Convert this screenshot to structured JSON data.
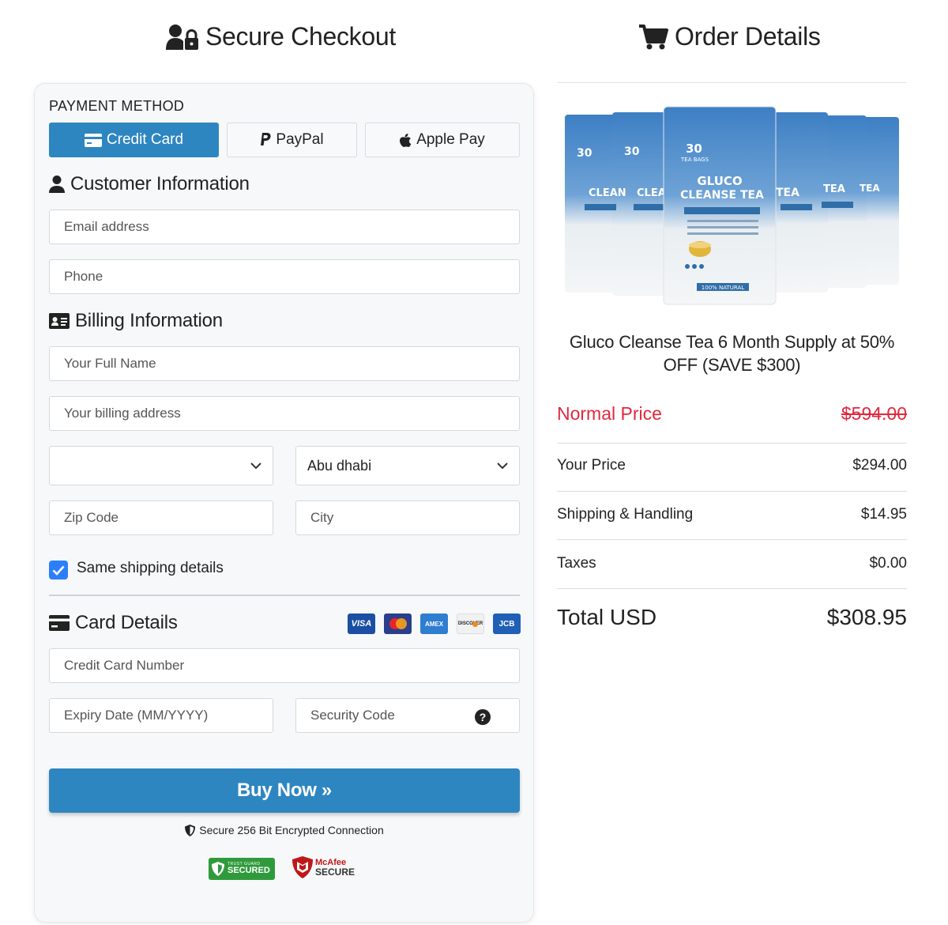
{
  "headers": {
    "checkout_title": "Secure Checkout",
    "order_title": "Order Details"
  },
  "payment": {
    "label": "PAYMENT METHOD",
    "tabs": [
      {
        "label": "Credit Card",
        "icon": "credit-card-icon",
        "active": true
      },
      {
        "label": "PayPal",
        "icon": "paypal-icon",
        "active": false
      },
      {
        "label": "Apple Pay",
        "icon": "apple-icon",
        "active": false
      }
    ]
  },
  "customer": {
    "heading": "Customer Information",
    "email_placeholder": "Email address",
    "phone_placeholder": "Phone"
  },
  "billing": {
    "heading": "Billing Information",
    "name_placeholder": "Your Full Name",
    "address_placeholder": "Your billing address",
    "country_value": "",
    "state_value": "Abu dhabi",
    "zip_placeholder": "Zip Code",
    "city_placeholder": "City",
    "same_shipping_label": "Same shipping details",
    "same_shipping_checked": true
  },
  "card": {
    "heading": "Card Details",
    "logos": [
      "VISA",
      "MASTERCARD",
      "AMEX",
      "DISCOVER",
      "JCB"
    ],
    "number_placeholder": "Credit Card Number",
    "expiry_placeholder": "Expiry Date (MM/YYYY)",
    "cvv_placeholder": "Security Code"
  },
  "buy_button": "Buy Now »",
  "secure_note": "Secure 256 Bit Encrypted Connection",
  "badges": {
    "trust_top": "TRUST GUARD",
    "trust_main": "SECURED",
    "mcafee_top": "McAfee",
    "mcafee_main": "SECURE"
  },
  "product": {
    "bag_count": "30",
    "bag_count_unit": "TEA BAGS",
    "bag_brand_1": "GLUCO",
    "bag_brand_2": "CLEANSE TEA",
    "bag_footer": "100% NATURAL",
    "name": "Gluco Cleanse Tea 6 Month Supply at 50% OFF (SAVE $300)"
  },
  "pricing": {
    "normal_label": "Normal Price",
    "normal_value": "$594.00",
    "your_label": "Your Price",
    "your_value": "$294.00",
    "shipping_label": "Shipping & Handling",
    "shipping_value": "$14.95",
    "taxes_label": "Taxes",
    "taxes_value": "$0.00",
    "total_label": "Total USD",
    "total_value": "$308.95"
  },
  "colors": {
    "accent": "#2e86c1",
    "normal_price": "#e0283f",
    "checkbox": "#2d7ff9",
    "trust_green": "#2f9a3b",
    "mcafee_red": "#c01818"
  }
}
